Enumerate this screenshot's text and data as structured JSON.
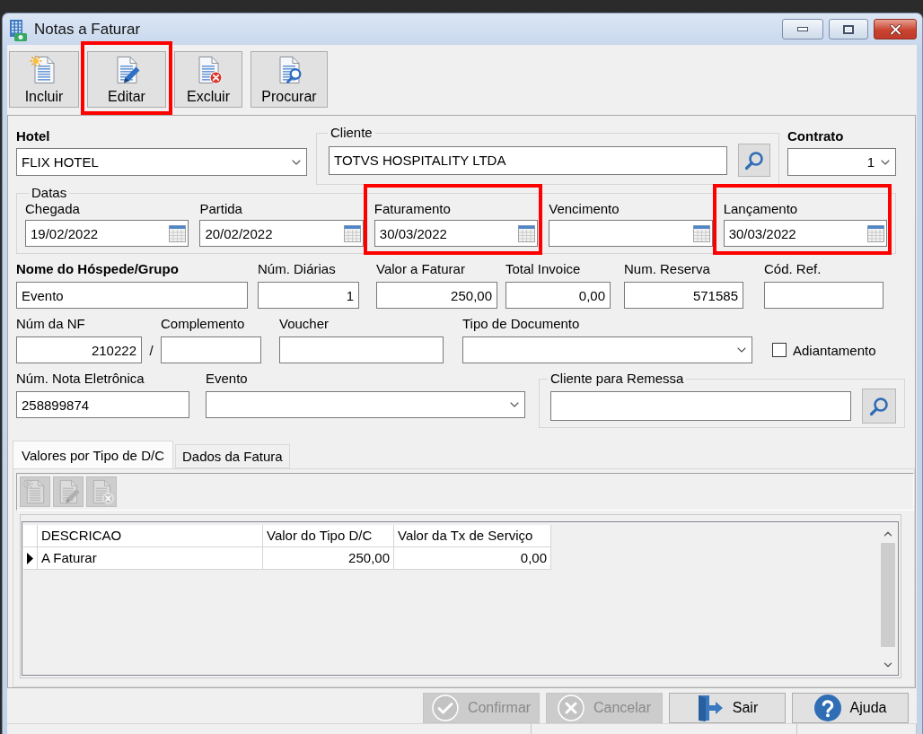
{
  "window": {
    "title": "Notas a Faturar"
  },
  "toolbar": [
    {
      "kind": "new",
      "label": "Incluir",
      "highlighted": false
    },
    {
      "kind": "edit",
      "label": "Editar",
      "highlighted": true
    },
    {
      "kind": "delete",
      "label": "Excluir",
      "highlighted": false
    },
    {
      "kind": "search",
      "label": "Procurar",
      "highlighted": false
    }
  ],
  "form": {
    "hotel": {
      "label": "Hotel",
      "required": true,
      "value": "FLIX HOTEL"
    },
    "cliente": {
      "legend": "Cliente",
      "required": false,
      "value": "TOTVS HOSPITALITY LTDA"
    },
    "contrato": {
      "label": "Contrato",
      "required": true,
      "value": "1"
    },
    "datas": {
      "legend": "Datas",
      "fields": [
        {
          "label": "Chegada",
          "required": false,
          "value": "19/02/2022",
          "highlighted": false
        },
        {
          "label": "Partida",
          "required": false,
          "value": "20/02/2022",
          "highlighted": false
        },
        {
          "label": "Faturamento",
          "required": false,
          "value": "30/03/2022",
          "highlighted": true
        },
        {
          "label": "Vencimento",
          "required": false,
          "highlighted": false
        },
        {
          "label": "Lançamento",
          "required": false,
          "value": "30/03/2022",
          "highlighted": true
        }
      ]
    },
    "line_1": [
      {
        "kind": "text",
        "label": "Nome do Hóspede/Grupo",
        "required": true,
        "value": "Evento"
      },
      {
        "kind": "number",
        "label": "Núm. Diárias",
        "required": false,
        "value": "1"
      },
      {
        "kind": "number",
        "label": "Valor a Faturar",
        "required": false,
        "value": "250,00"
      },
      {
        "kind": "number",
        "label": "Total Invoice",
        "required": false,
        "value": "0,00"
      },
      {
        "kind": "number",
        "label": "Num. Reserva",
        "required": false,
        "value": "571585"
      },
      {
        "kind": "text",
        "label": "Cód. Ref.",
        "required": false
      }
    ],
    "line_2": [
      {
        "kind": "number",
        "label": "Núm da NF",
        "required": false,
        "value": "210222"
      },
      {
        "kind": "separator",
        "text": "/"
      },
      {
        "kind": "text",
        "label": "Complemento",
        "required": false
      },
      {
        "kind": "text",
        "label": "Voucher",
        "required": false
      },
      {
        "kind": "select",
        "label": "Tipo de Documento",
        "required": false
      },
      {
        "kind": "checkbox",
        "label": "Adiantamento",
        "required": false,
        "checked": false
      }
    ],
    "line_3": [
      {
        "kind": "text",
        "label": "Núm. Nota Eletrônica",
        "required": false,
        "value": "258899874"
      },
      {
        "kind": "select",
        "label": "Evento",
        "required": false
      },
      {
        "kind": "lookup",
        "legend": "Cliente para Remessa",
        "required": false
      }
    ]
  },
  "tabs": [
    {
      "label": "Valores por Tipo de D/C",
      "selected": true
    },
    {
      "label": "Dados da Fatura",
      "selected": false
    }
  ],
  "grid_toolbar": [
    {
      "kind": "new",
      "disabled": true
    },
    {
      "kind": "edit",
      "disabled": true
    },
    {
      "kind": "delete",
      "disabled": true
    }
  ],
  "table": {
    "columns": [
      {
        "title": "DESCRICAO",
        "kind": "text"
      },
      {
        "title": "Valor do Tipo D/C",
        "kind": "number"
      },
      {
        "title": "Valor da Tx de Serviço",
        "kind": "number"
      }
    ],
    "rows": [
      {
        "current": true,
        "cells": [
          "A Faturar",
          "250,00",
          "0,00"
        ]
      }
    ]
  },
  "buttons": [
    {
      "kind": "confirm",
      "label": "Confirmar",
      "disabled": true
    },
    {
      "kind": "cancel",
      "label": "Cancelar",
      "disabled": true
    },
    {
      "kind": "exit",
      "label": "Sair",
      "disabled": false
    },
    {
      "kind": "help",
      "label": "Ajuda",
      "disabled": false
    }
  ]
}
